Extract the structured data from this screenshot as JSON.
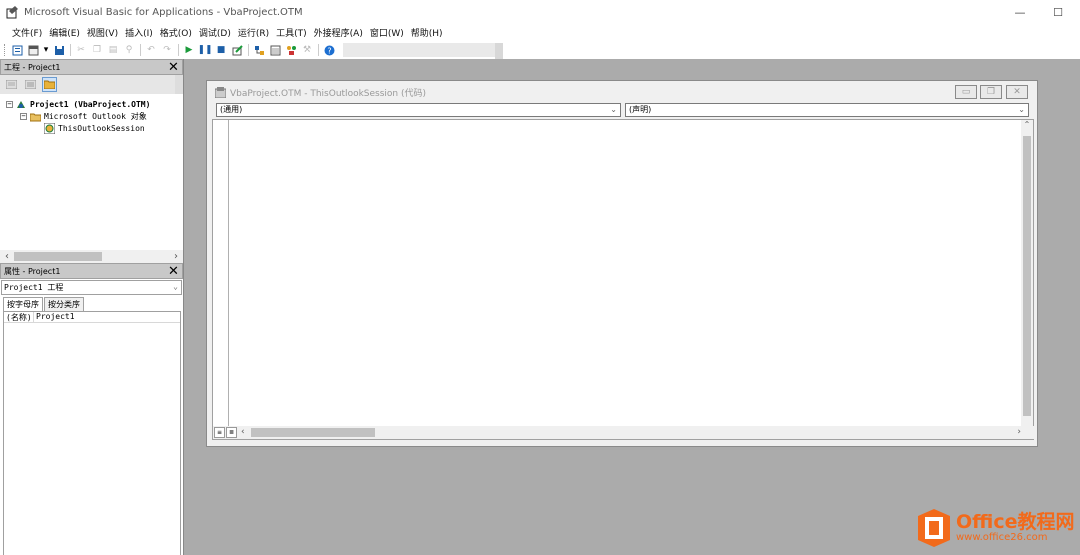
{
  "window": {
    "title": "Microsoft Visual Basic for Applications - VbaProject.OTM",
    "minimize_glyph": "—",
    "maximize_glyph": "☐"
  },
  "menu": [
    "文件(F)",
    "编辑(E)",
    "视图(V)",
    "插入(I)",
    "格式(O)",
    "调试(D)",
    "运行(R)",
    "工具(T)",
    "外接程序(A)",
    "窗口(W)",
    "帮助(H)"
  ],
  "project_pane": {
    "title": "工程 - Project1",
    "tree": {
      "root_label": "Project1 (VbaProject.OTM)",
      "folder_label": "Microsoft Outlook 对象",
      "session_label": "ThisOutlookSession",
      "expand_glyph": "−"
    }
  },
  "properties_pane": {
    "title": "属性 - Project1",
    "object_combo": "Project1 工程",
    "tabs": [
      "按字母序",
      "按分类序"
    ],
    "rows": [
      {
        "name": "(名称)",
        "value": "Project1"
      }
    ]
  },
  "code_window": {
    "title": "VbaProject.OTM - ThisOutlookSession (代码)",
    "object_combo": "(通用)",
    "procedure_combo": "(声明)"
  },
  "watermark": {
    "title": "Office教程网",
    "url": "www.office26.com"
  },
  "colors": {
    "mdi_background": "#ababab",
    "watermark_orange": "#f26a1b"
  }
}
